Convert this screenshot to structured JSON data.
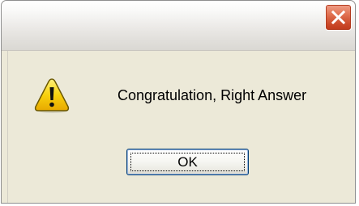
{
  "dialog": {
    "title": "",
    "message": "Congratulation, Right Answer",
    "icon": "warning-icon",
    "ok_label": "OK",
    "close_icon": "close-icon"
  },
  "colors": {
    "close_button": "#d8542f",
    "dialog_face": "#ece9d8",
    "warning_yellow": "#f8d10e",
    "ok_border": "#003c74"
  }
}
